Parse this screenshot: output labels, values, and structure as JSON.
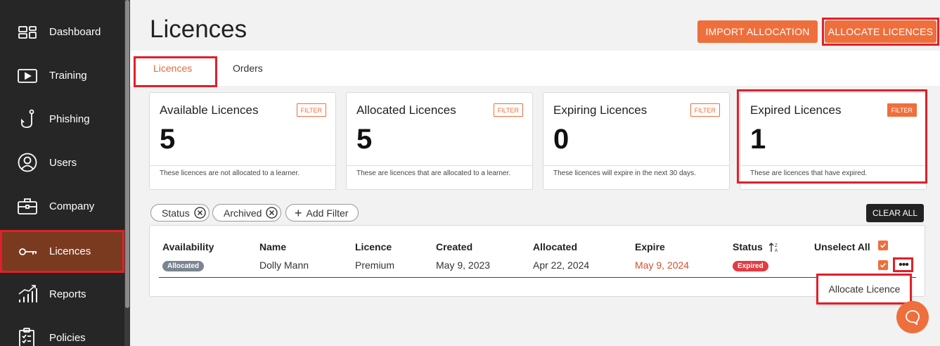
{
  "sidebar": {
    "items": [
      {
        "label": "Dashboard",
        "icon": "dashboard-icon"
      },
      {
        "label": "Training",
        "icon": "play-icon"
      },
      {
        "label": "Phishing",
        "icon": "hook-icon"
      },
      {
        "label": "Users",
        "icon": "user-icon"
      },
      {
        "label": "Company",
        "icon": "briefcase-icon"
      },
      {
        "label": "Licences",
        "icon": "key-icon",
        "active": true
      },
      {
        "label": "Reports",
        "icon": "chart-icon"
      },
      {
        "label": "Policies",
        "icon": "clipboard-icon"
      }
    ]
  },
  "header": {
    "title": "Licences",
    "import_label": "IMPORT ALLOCATION",
    "allocate_label": "ALLOCATE LICENCES"
  },
  "tabs": [
    {
      "label": "Licences",
      "active": true
    },
    {
      "label": "Orders",
      "active": false
    }
  ],
  "cards": [
    {
      "title": "Available Licences",
      "filter": "FILTER",
      "value": "5",
      "desc": "These licences are not allocated to a learner."
    },
    {
      "title": "Allocated Licences",
      "filter": "FILTER",
      "value": "5",
      "desc": "These are licences that are allocated to a learner."
    },
    {
      "title": "Expiring Licences",
      "filter": "FILTER",
      "value": "0",
      "desc": "These licences will expire in the next 30 days."
    },
    {
      "title": "Expired Licences",
      "filter": "FILTER",
      "value": "1",
      "desc": "These are licences that have expired."
    }
  ],
  "filters": {
    "chips": [
      "Status",
      "Archived"
    ],
    "add_label": "Add Filter",
    "clear_label": "CLEAR ALL"
  },
  "table": {
    "columns": [
      "Availability",
      "Name",
      "Licence",
      "Created",
      "Allocated",
      "Expire",
      "Status"
    ],
    "unselect_label": "Unselect All",
    "row": {
      "availability": "Allocated",
      "name": "Dolly Mann",
      "licence": "Premium",
      "created": "May 9, 2023",
      "allocated": "Apr 22, 2024",
      "expire": "May 9, 2024",
      "status": "Expired"
    },
    "more_label": "•••"
  },
  "dropdown": {
    "item": "Allocate Licence"
  },
  "colors": {
    "accent": "#ee6f3c",
    "sidebar": "#262626",
    "highlight": "#e0202a"
  }
}
